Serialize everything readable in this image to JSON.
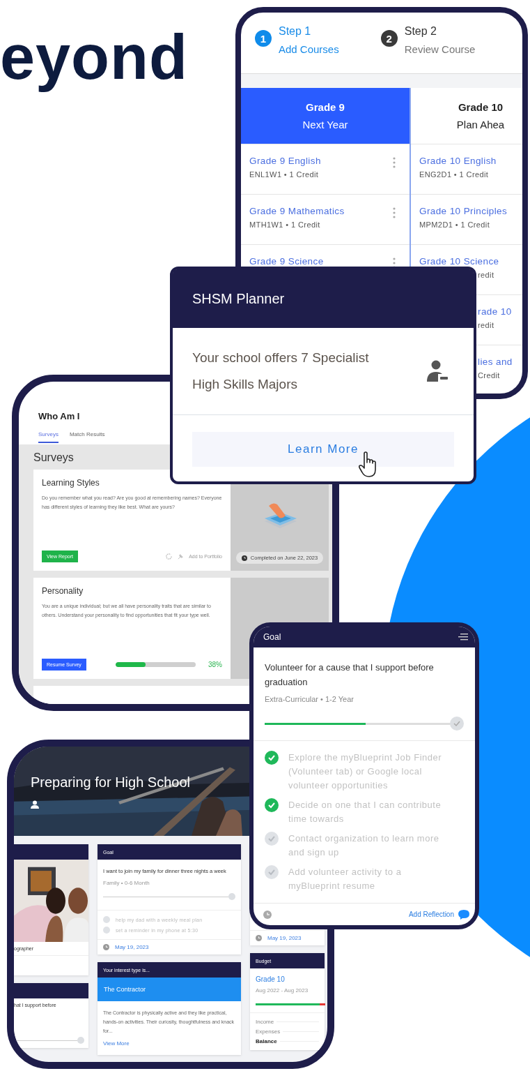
{
  "headline": "eyond",
  "course_planner": {
    "steps": [
      {
        "number": "1",
        "title": "Step 1",
        "subtitle": "Add Courses",
        "selected": true
      },
      {
        "number": "2",
        "title": "Step 2",
        "subtitle": "Review Course",
        "selected": false
      }
    ],
    "grades": [
      {
        "title": "Grade 9",
        "subtitle": "Next Year",
        "selected": true,
        "courses": [
          {
            "name": "Grade 9 English",
            "detail": "ENL1W1 • 1 Credit",
            "kind": "full",
            "has_menu": true
          },
          {
            "name": "Grade 9 Mathematics",
            "detail": "MTH1W1 • 1 Credit",
            "kind": "full",
            "has_menu": true
          },
          {
            "name": "Grade 9 Science",
            "kind": "full",
            "has_menu": true
          }
        ]
      },
      {
        "title": "Grade 10",
        "subtitle": "Plan Ahea",
        "selected": false,
        "courses": [
          {
            "name": "Grade 10 English",
            "detail": "ENG2D1 • 1 Credit",
            "kind": "full",
            "has_menu": false
          },
          {
            "name": "Grade 10 Principles",
            "detail": "MPM2D1 • 1 Credit",
            "kind": "full",
            "has_menu": false
          },
          {
            "name": "Grade 10 Science",
            "detail": "redit",
            "kind": "detail_behind",
            "has_menu": false
          },
          {
            "name": "rade 10",
            "detail": "redit",
            "kind": "behind",
            "has_menu": false
          },
          {
            "name": "lies and",
            "detail": "Credit",
            "kind": "behind",
            "has_menu": false
          }
        ]
      }
    ]
  },
  "shsm_card": {
    "title": "SHSM Planner",
    "text": "Your school offers 7 Specialist High Skills Majors",
    "button": "Learn More"
  },
  "who_am_i": {
    "title": "Who Am I",
    "tabs": [
      {
        "label": "Surveys",
        "selected": true
      },
      {
        "label": "Match Results",
        "selected": false
      }
    ],
    "section": "Surveys",
    "surveys": [
      {
        "title": "Learning Styles",
        "text": "Do you remember what you read? Are you good at remembering names? Everyone has different styles of learning they like best. What are yours?",
        "kind": "completed",
        "button": "View Report",
        "action": "Add to Portfolio",
        "status": "Completed on June 22, 2023"
      },
      {
        "title": "Personality",
        "text": "You are a unique individual; but we all have personality traits that are similar to others. Understand your personality to find opportunities that fit your type well.",
        "kind": "in_progress",
        "button": "Resume Survey",
        "level": 0.38,
        "reading": "38%"
      }
    ]
  },
  "goal": {
    "header": "Goal",
    "title": "Volunteer for a cause that I support before graduation",
    "meta": "Extra-Curricular • 1-2 Year",
    "level": 0.53,
    "steps": [
      {
        "text": "Explore the myBlueprint Job Finder (Volunteer tab) or Google local volunteer opportunities",
        "checked": true
      },
      {
        "text": "Decide on one that I can contribute time towards",
        "checked": true
      },
      {
        "text": "Contact organization to learn more and sign up",
        "checked": false
      },
      {
        "text": "Add volunteer activity to a myBlueprint resume",
        "checked": false
      }
    ],
    "link": "Add Reflection"
  },
  "portfolio": {
    "title": "Preparing for High School",
    "career_card": {
      "caption": "ographer"
    },
    "goal_preview": {
      "text": "hat I support before"
    },
    "goal_card": {
      "header": "Goal",
      "title": "I want to join my family for dinner three nights a week",
      "meta": "Family • 0-6 Month",
      "steps": [
        {
          "text": "help my dad with a weekly meal plan",
          "checked": false
        },
        {
          "text": "set a reminder in my phone at 5:30",
          "checked": false
        }
      ],
      "date": "May 19, 2023"
    },
    "interest_card": {
      "header": "Your interest type is...",
      "type": "The Contractor",
      "text": "The Contractor is physically active and they like practical, hands-on activities. Their curiosity, thoughtfulness and knack for...",
      "link": "View More"
    },
    "date_card": {
      "date": "May 19, 2023"
    },
    "budget_card": {
      "header": "Budget",
      "title": "Grade 10",
      "period": "Aug 2022 - Aug 2023",
      "rows": [
        {
          "label": "Income",
          "kind": "plain"
        },
        {
          "label": "Expenses",
          "kind": "plain"
        },
        {
          "label": "Balance",
          "kind": "total"
        }
      ]
    }
  }
}
